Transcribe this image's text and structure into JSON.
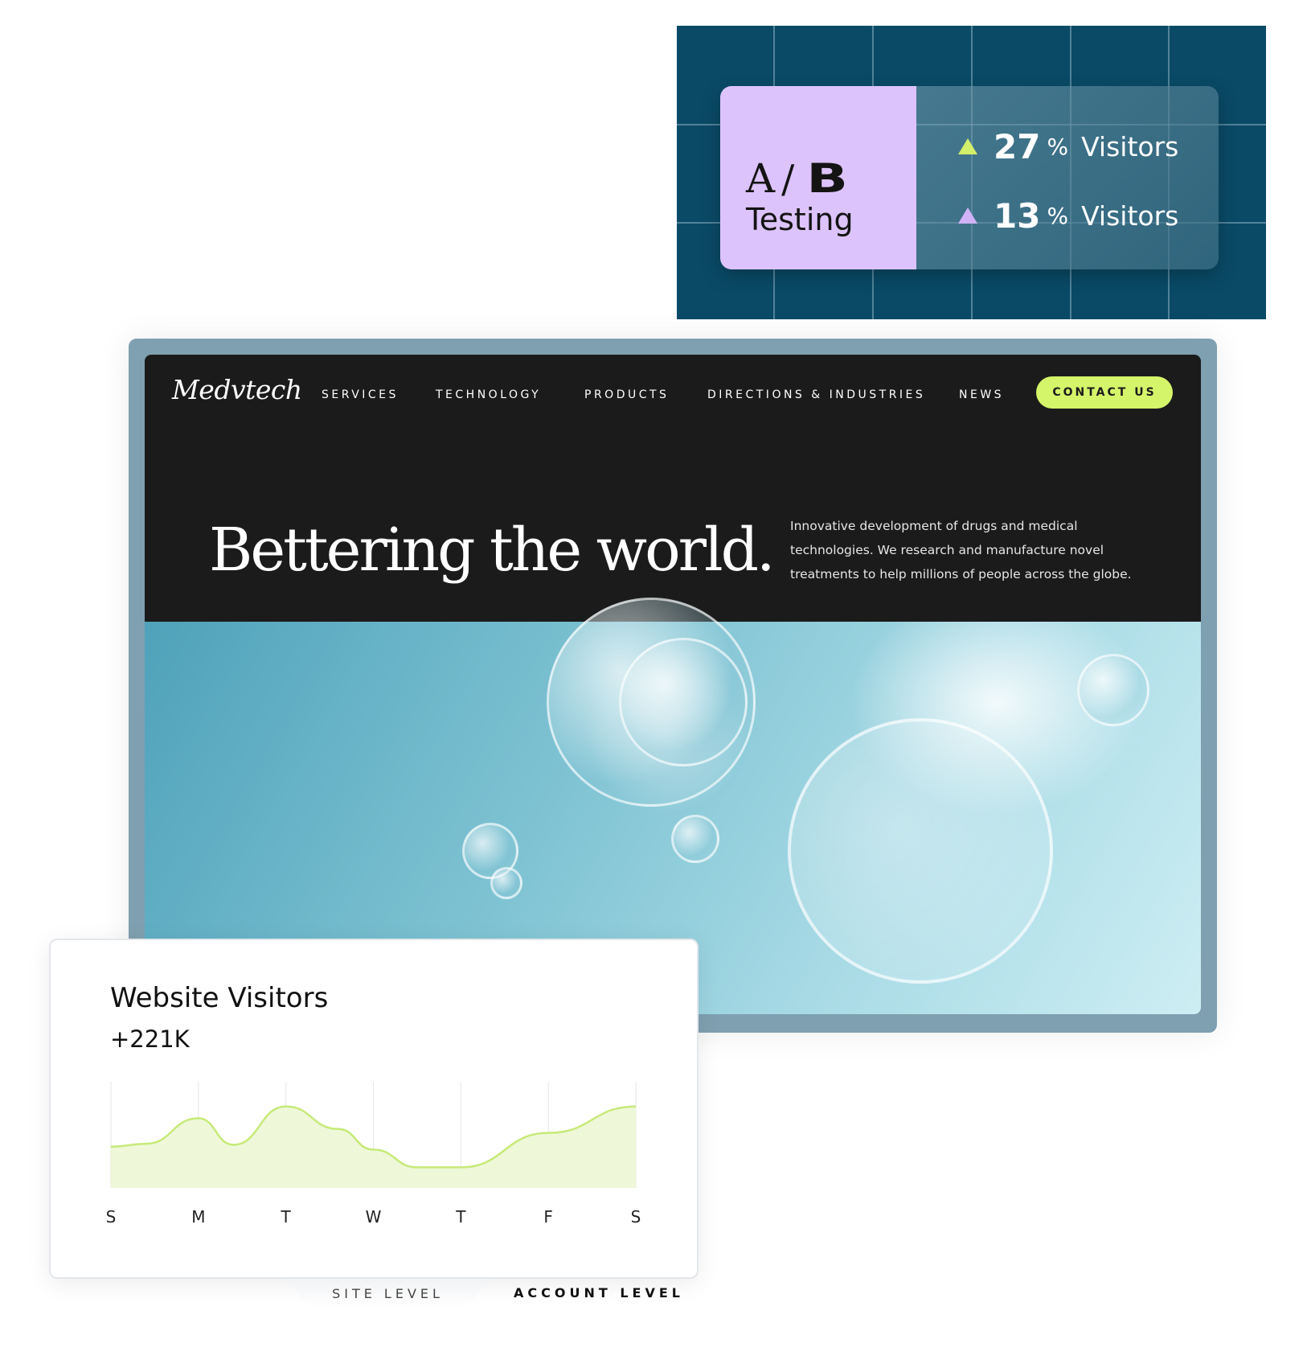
{
  "ab_testing": {
    "title_a": "A",
    "title_slash": "/",
    "title_b": "B",
    "subtitle": "Testing",
    "stats": [
      {
        "value": "27",
        "unit": "%",
        "label": "Visitors",
        "arrow": "triangle-up-icon",
        "color": "#d2f06b"
      },
      {
        "value": "13",
        "unit": "%",
        "label": "Visitors",
        "arrow": "triangle-up-icon",
        "color": "#d0b3f6"
      }
    ],
    "colors": {
      "panel_bg": "#0a4a66",
      "card_left_bg": "#ddc3fb"
    }
  },
  "website": {
    "logo": "Medvtech",
    "nav": {
      "services": "SERVICES",
      "technology": "TECHNOLOGY",
      "products": "PRODUCTS",
      "directions": "DIRECTIONS & INDUSTRIES",
      "news": "NEWS",
      "contact": "CONTACT US"
    },
    "hero": {
      "headline": "Bettering the world.",
      "description": "Innovative development of drugs and medical technologies. We research and manufacture novel treatments to help millions of people across the globe."
    },
    "colors": {
      "nav_bg": "#1b1b1b",
      "accent": "#d4f56a"
    }
  },
  "visitors": {
    "title": "Website Visitors",
    "value": "+221K",
    "tabs": {
      "site": "SITE LEVEL",
      "account": "ACCOUNT LEVEL"
    }
  },
  "chart_data": {
    "type": "area",
    "categories": [
      "S",
      "M",
      "T",
      "W",
      "T",
      "F",
      "S"
    ],
    "title": "",
    "xlabel": "",
    "ylabel": "",
    "ylim": [
      0,
      100
    ],
    "grid": true,
    "series": [
      {
        "x": [
          0,
          0.4,
          1.0,
          1.4,
          2.0,
          2.6,
          3.0,
          3.5,
          4.0,
          5.0,
          6.0
        ],
        "values": [
          42,
          45,
          71,
          44,
          83,
          60,
          39,
          21,
          21,
          56,
          83
        ]
      }
    ],
    "colors": {
      "line": "#c6ea78",
      "fill": "#eef8d9"
    }
  }
}
